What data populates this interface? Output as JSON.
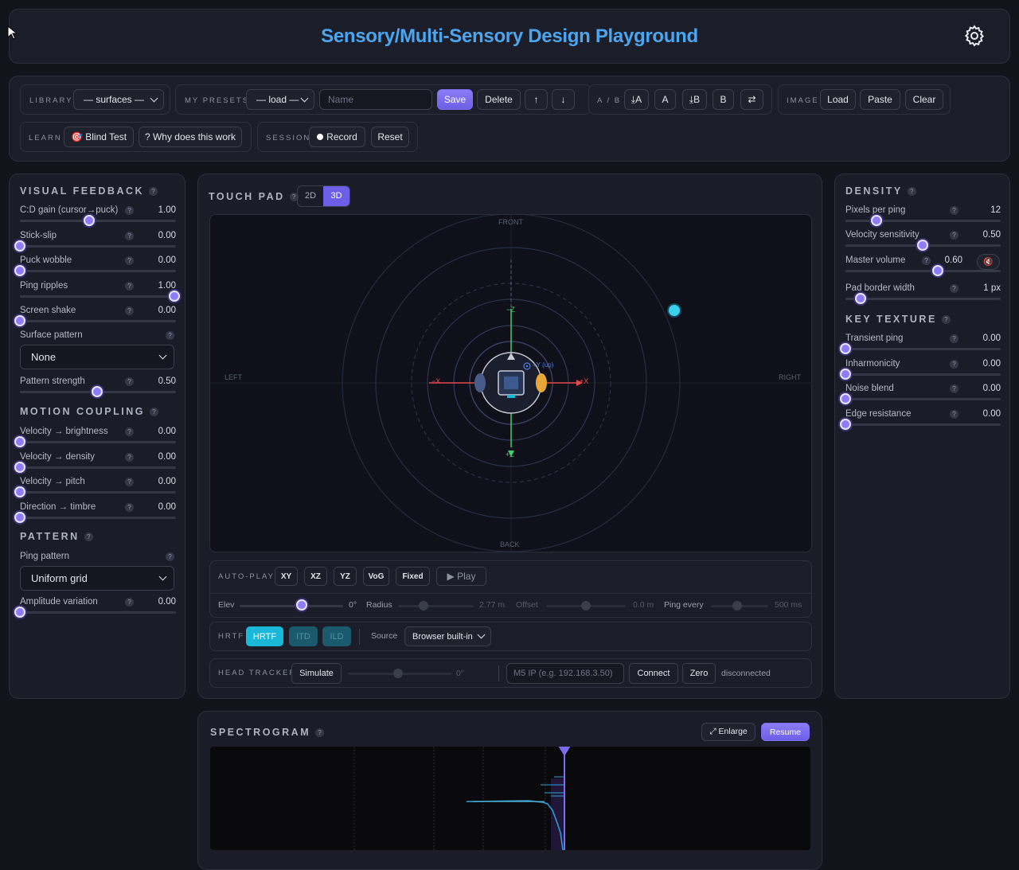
{
  "header": {
    "title": "Sensory/Multi-Sensory Design Playground",
    "settings_icon": "gear-icon"
  },
  "toolbar": {
    "library": {
      "label": "LIBRARY",
      "value": "— surfaces —"
    },
    "presets": {
      "label": "MY PRESETS",
      "value": "— load —",
      "name_placeholder": "Name",
      "save": "Save",
      "delete": "Delete",
      "up": "↑",
      "down": "↓"
    },
    "ab": {
      "label": "A / B",
      "save_a": "⤓A",
      "a": "A",
      "save_b": "⤓B",
      "b": "B",
      "swap": "⇄"
    },
    "image": {
      "label": "IMAGE",
      "load": "Load",
      "paste": "Paste",
      "clear": "Clear"
    },
    "learn": {
      "label": "LEARN",
      "blind": "🎯 Blind Test",
      "why": "? Why does this work"
    },
    "session": {
      "label": "SESSION",
      "record": "Record",
      "reset": "Reset"
    }
  },
  "visual": {
    "title": "VISUAL FEEDBACK",
    "sliders": [
      {
        "label": "C:D gain (cursor→puck)",
        "value": "1.00",
        "pos": 0.45
      },
      {
        "label": "Stick-slip",
        "value": "0.00",
        "pos": 0
      },
      {
        "label": "Puck wobble",
        "value": "0.00",
        "pos": 0
      },
      {
        "label": "Ping ripples",
        "value": "1.00",
        "pos": 1
      },
      {
        "label": "Screen shake",
        "value": "0.00",
        "pos": 0
      }
    ],
    "surface_label": "Surface pattern",
    "surface_value": "None",
    "strength": {
      "label": "Pattern strength",
      "value": "0.50",
      "pos": 0.5
    }
  },
  "motion": {
    "title": "MOTION COUPLING",
    "sliders": [
      {
        "label": "Velocity → brightness",
        "value": "0.00",
        "pos": 0
      },
      {
        "label": "Velocity → density",
        "value": "0.00",
        "pos": 0
      },
      {
        "label": "Velocity → pitch",
        "value": "0.00",
        "pos": 0
      },
      {
        "label": "Direction → timbre",
        "value": "0.00",
        "pos": 0
      }
    ]
  },
  "pattern": {
    "title": "PATTERN",
    "ping_label": "Ping pattern",
    "ping_value": "Uniform grid",
    "amp": {
      "label": "Amplitude variation",
      "value": "0.00",
      "pos": 0
    }
  },
  "touchpad": {
    "title": "TOUCH PAD",
    "mode_2d": "2D",
    "mode_3d": "3D",
    "labels": {
      "front": "FRONT",
      "back": "BACK",
      "left": "LEFT",
      "right": "RIGHT",
      "neg_z": "−Z",
      "pos_z": "+Z",
      "neg_x": "−X",
      "pos_x": "+X",
      "pos_y": "+Y (up)"
    }
  },
  "autoplay": {
    "label": "AUTO-PLAY",
    "xy": "XY",
    "xz": "XZ",
    "yz": "YZ",
    "vog": "VoG",
    "fixed": "Fixed",
    "play": "▶ Play",
    "elev_label": "Elev",
    "elev_value": "0°",
    "elev_pos": 0.6,
    "radius_label": "Radius",
    "radius_value": "2.77 m",
    "offset_label": "Offset",
    "offset_value": "0.0 m",
    "ping_label": "Ping every",
    "ping_value": "500 ms"
  },
  "hrtf": {
    "label": "HRTF",
    "hrtf": "HRTF",
    "itd": "ITD",
    "ild": "ILD",
    "source_label": "Source",
    "source_value": "Browser built-in"
  },
  "tracker": {
    "label": "HEAD TRACKER",
    "simulate": "Simulate",
    "angle": "0°",
    "ip_placeholder": "M5 IP (e.g. 192.168.3.50)",
    "connect": "Connect",
    "zero": "Zero",
    "status": "disconnected"
  },
  "density": {
    "title": "DENSITY",
    "sliders": [
      {
        "label": "Pixels per ping",
        "value": "12",
        "pos": 0.2
      },
      {
        "label": "Velocity sensitivity",
        "value": "0.50",
        "pos": 0.5
      },
      {
        "label": "Master volume",
        "value": "0.60",
        "pos": 0.6
      },
      {
        "label": "Pad border width",
        "value": "1 px",
        "pos": 0.1
      }
    ]
  },
  "key_texture": {
    "title": "KEY TEXTURE",
    "sliders": [
      {
        "label": "Transient ping",
        "value": "0.00",
        "pos": 0
      },
      {
        "label": "Inharmonicity",
        "value": "0.00",
        "pos": 0
      },
      {
        "label": "Noise blend",
        "value": "0.00",
        "pos": 0
      },
      {
        "label": "Edge resistance",
        "value": "0.00",
        "pos": 0
      }
    ]
  },
  "spectrogram": {
    "title": "SPECTROGRAM",
    "enlarge": "⤢ Enlarge",
    "resume": "Resume"
  },
  "colors": {
    "accent": "#7c6cf3",
    "cyan": "#19b8d8",
    "title_grad": "#4aa6f0"
  }
}
